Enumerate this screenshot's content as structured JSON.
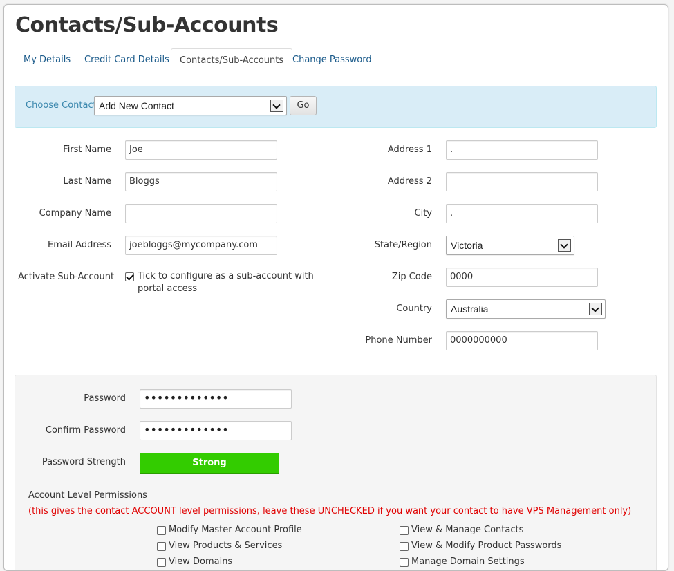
{
  "page": {
    "title": "Contacts/Sub-Accounts"
  },
  "tabs": [
    {
      "label": "My Details",
      "active": false
    },
    {
      "label": "Credit Card Details",
      "active": false
    },
    {
      "label": "Contacts/Sub-Accounts",
      "active": true
    },
    {
      "label": "Change Password",
      "active": false
    }
  ],
  "contact_chooser": {
    "label": "Choose Contact:",
    "selected": "Add New Contact",
    "go_label": "Go"
  },
  "form": {
    "first_name": {
      "label": "First Name",
      "value": "Joe"
    },
    "last_name": {
      "label": "Last Name",
      "value": "Bloggs"
    },
    "company_name": {
      "label": "Company Name",
      "value": ""
    },
    "email": {
      "label": "Email Address",
      "value": "joebloggs@mycompany.com"
    },
    "activate": {
      "label": "Activate Sub-Account",
      "checked": true,
      "text": "Tick to configure as a sub-account with portal access"
    },
    "address1": {
      "label": "Address 1",
      "value": "."
    },
    "address2": {
      "label": "Address 2",
      "value": ""
    },
    "city": {
      "label": "City",
      "value": "."
    },
    "state": {
      "label": "State/Region",
      "value": "Victoria"
    },
    "zip": {
      "label": "Zip Code",
      "value": "0000"
    },
    "country": {
      "label": "Country",
      "value": "Australia"
    },
    "phone": {
      "label": "Phone Number",
      "value": "0000000000"
    }
  },
  "password_section": {
    "password": {
      "label": "Password",
      "value": "•••••••••••••"
    },
    "confirm": {
      "label": "Confirm Password",
      "value": "•••••••••••••"
    },
    "strength": {
      "label": "Password Strength",
      "value": "Strong",
      "color": "#33cc00"
    },
    "permissions_heading": "Account Level Permissions",
    "permissions_note": "(this gives the contact ACCOUNT level permissions, leave these UNCHECKED if you want your contact to have VPS Management only)",
    "permissions_left": [
      {
        "label": "Modify Master Account Profile",
        "checked": false
      },
      {
        "label": "View Products & Services",
        "checked": false
      },
      {
        "label": "View Domains",
        "checked": false
      }
    ],
    "permissions_right": [
      {
        "label": "View & Manage Contacts",
        "checked": false
      },
      {
        "label": "View & Modify Product Passwords",
        "checked": false
      },
      {
        "label": "Manage Domain Settings",
        "checked": false
      }
    ]
  }
}
